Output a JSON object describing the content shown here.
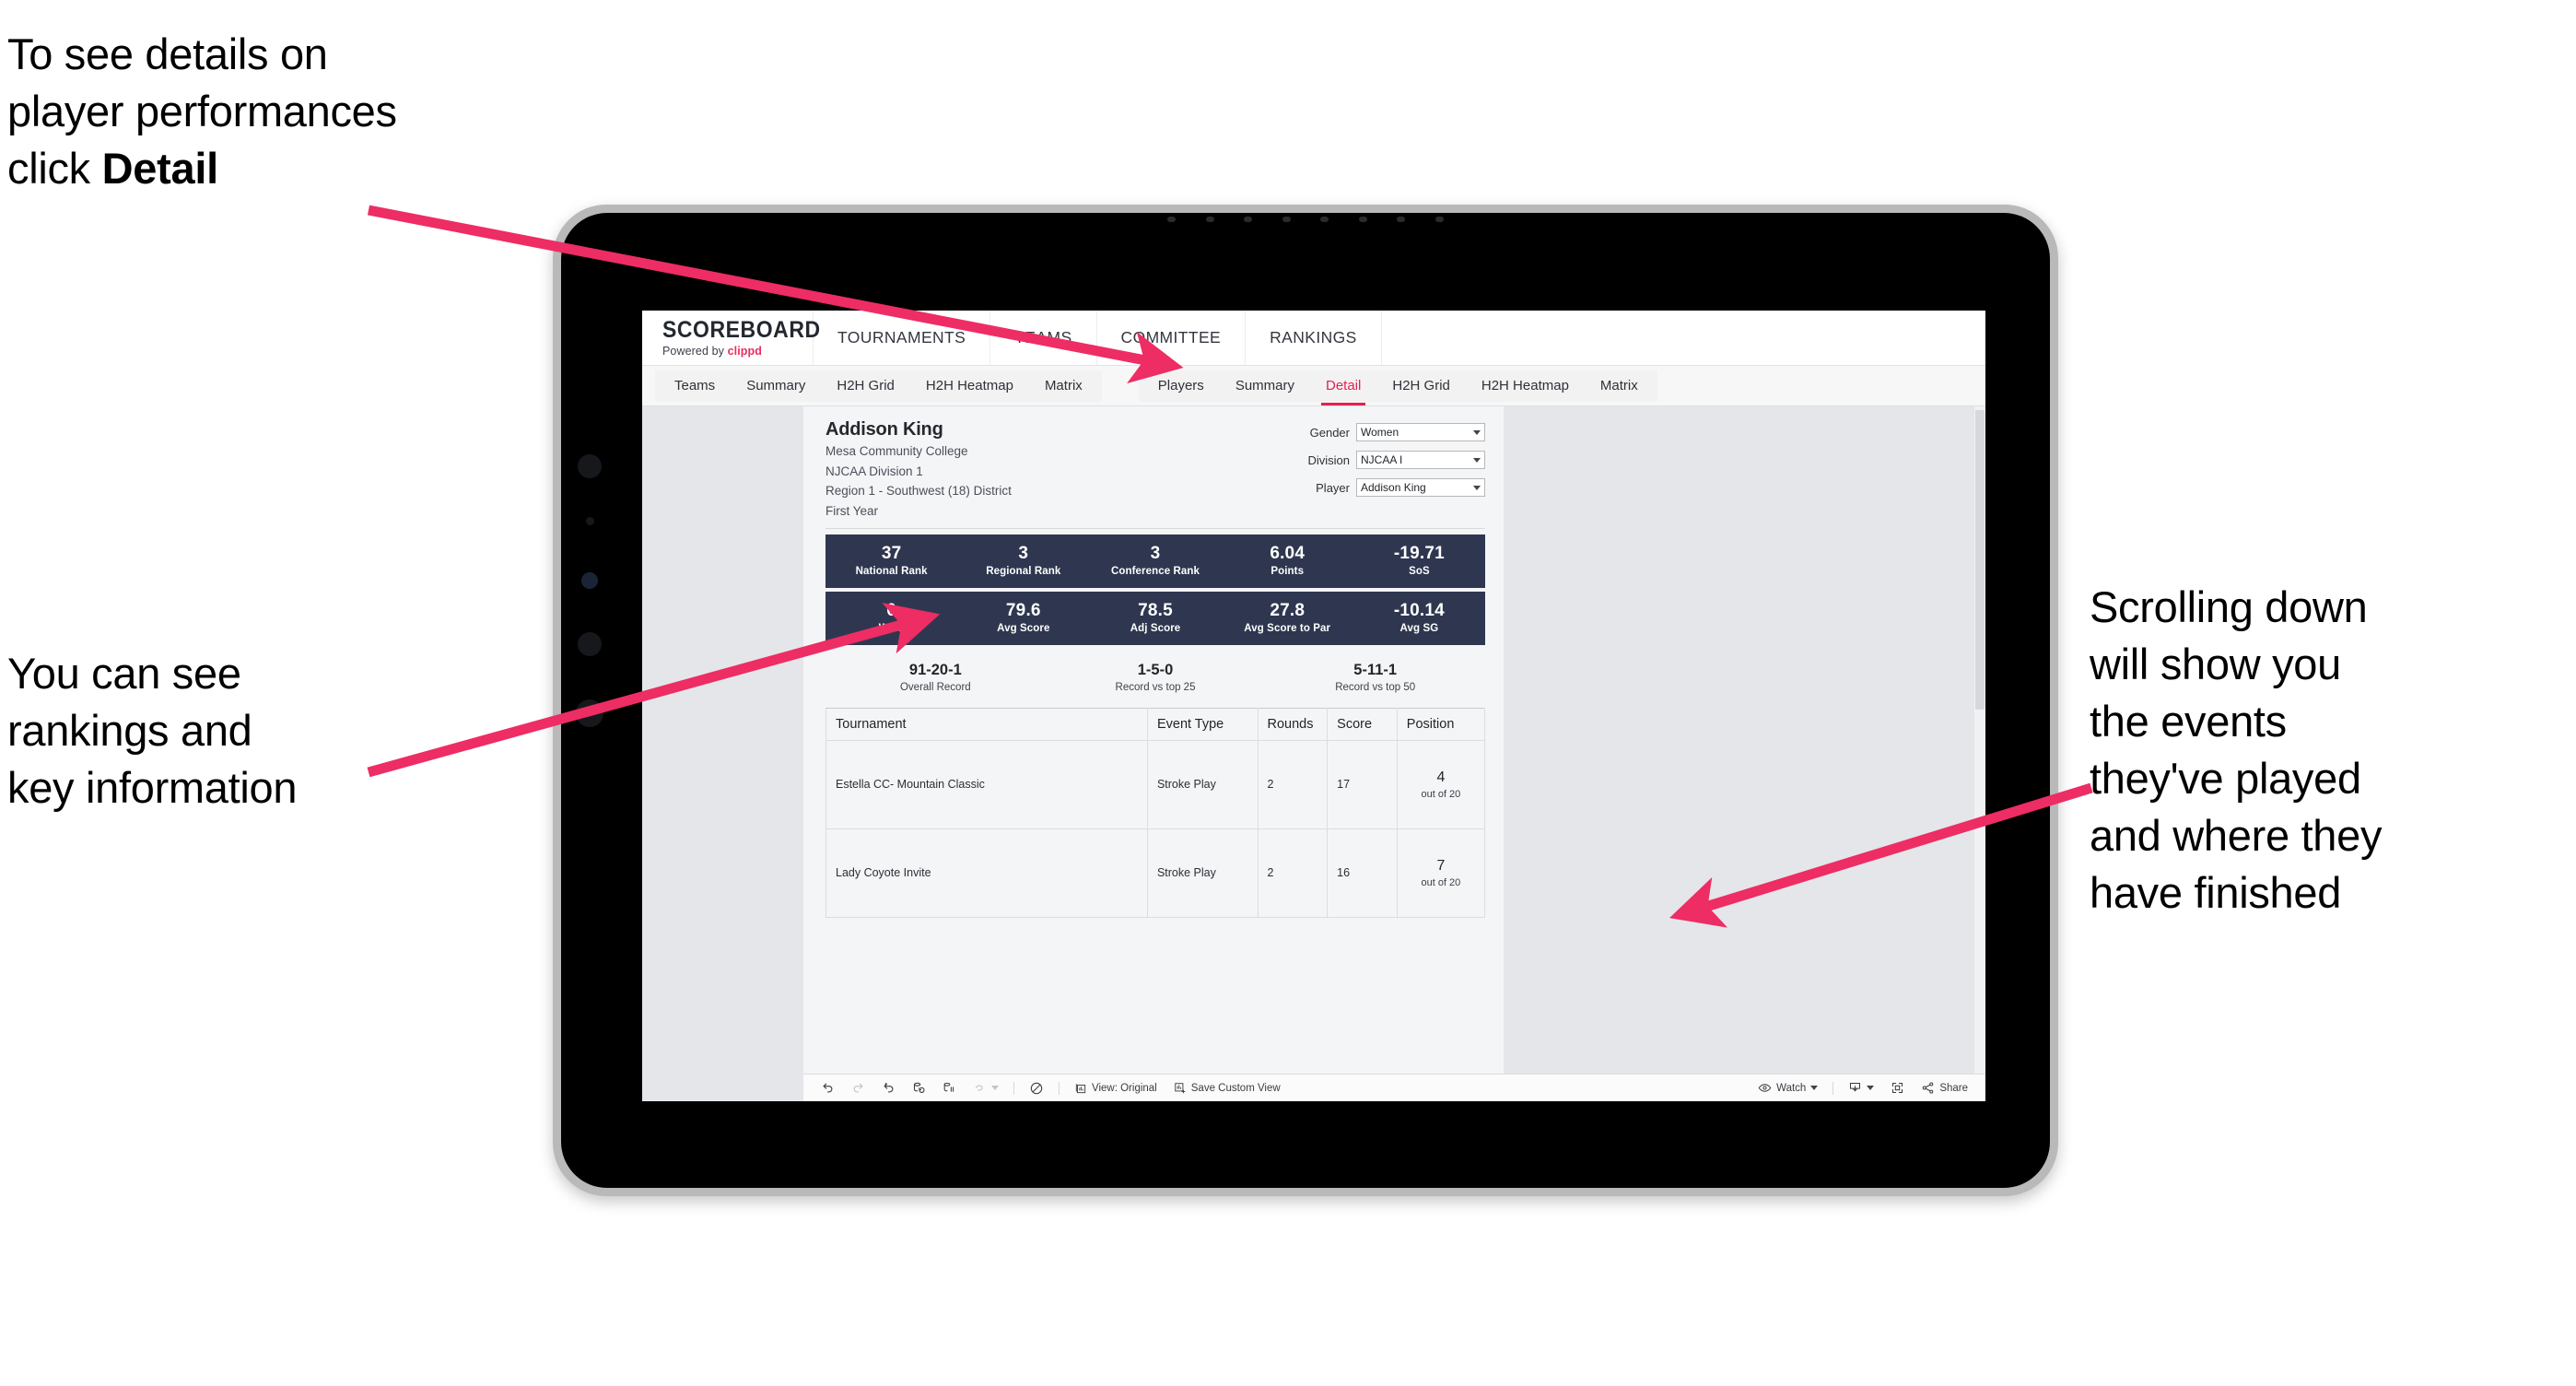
{
  "annotations": {
    "top_left": "To see details on\nplayer performances\nclick ",
    "top_left_bold": "Detail",
    "left": "You can see\nrankings and\nkey information",
    "right": "Scrolling down\nwill show you\nthe events\nthey've played\nand where they\nhave finished",
    "arrow_color": "#ED2D64"
  },
  "app": {
    "logo_main": "SCOREBOARD",
    "logo_sub_prefix": "Powered by ",
    "logo_sub_brand": "clippd",
    "top_nav": [
      "TOURNAMENTS",
      "TEAMS",
      "COMMITTEE",
      "RANKINGS"
    ],
    "tab_group_teams": [
      "Teams",
      "Summary",
      "H2H Grid",
      "H2H Heatmap",
      "Matrix"
    ],
    "tab_group_players": [
      "Players",
      "Summary",
      "Detail",
      "H2H Grid",
      "H2H Heatmap",
      "Matrix"
    ],
    "active_tab": "Detail",
    "accent_color": "#E6204F",
    "band_color": "#2F3750"
  },
  "player": {
    "name": "Addison King",
    "school": "Mesa Community College",
    "division": "NJCAA Division 1",
    "region": "Region 1 - Southwest (18) District",
    "year": "First Year"
  },
  "filters": [
    {
      "label": "Gender",
      "value": "Women"
    },
    {
      "label": "Division",
      "value": "NJCAA I"
    },
    {
      "label": "Player",
      "value": "Addison King"
    }
  ],
  "stats_band_1": [
    {
      "value": "37",
      "label": "National Rank"
    },
    {
      "value": "3",
      "label": "Regional Rank"
    },
    {
      "value": "3",
      "label": "Conference Rank"
    },
    {
      "value": "6.04",
      "label": "Points"
    },
    {
      "value": "-19.71",
      "label": "SoS"
    }
  ],
  "stats_band_2": [
    {
      "value": "0",
      "label": "Wins"
    },
    {
      "value": "79.6",
      "label": "Avg Score"
    },
    {
      "value": "78.5",
      "label": "Adj Score"
    },
    {
      "value": "27.8",
      "label": "Avg Score to Par"
    },
    {
      "value": "-10.14",
      "label": "Avg SG"
    }
  ],
  "records": [
    {
      "value": "91-20-1",
      "label": "Overall Record"
    },
    {
      "value": "1-5-0",
      "label": "Record vs top 25"
    },
    {
      "value": "5-11-1",
      "label": "Record vs top 50"
    }
  ],
  "events_table": {
    "columns": [
      "Tournament",
      "Event Type",
      "Rounds",
      "Score",
      "Position"
    ],
    "rows": [
      {
        "tournament": "Estella CC- Mountain Classic",
        "event_type": "Stroke Play",
        "rounds": "2",
        "score": "17",
        "position": "4",
        "position_of": "out of 20"
      },
      {
        "tournament": "Lady Coyote Invite",
        "event_type": "Stroke Play",
        "rounds": "2",
        "score": "16",
        "position": "7",
        "position_of": "out of 20"
      }
    ]
  },
  "toolbar": {
    "view_label": "View: Original",
    "save_label": "Save Custom View",
    "watch_label": "Watch",
    "share_label": "Share"
  }
}
